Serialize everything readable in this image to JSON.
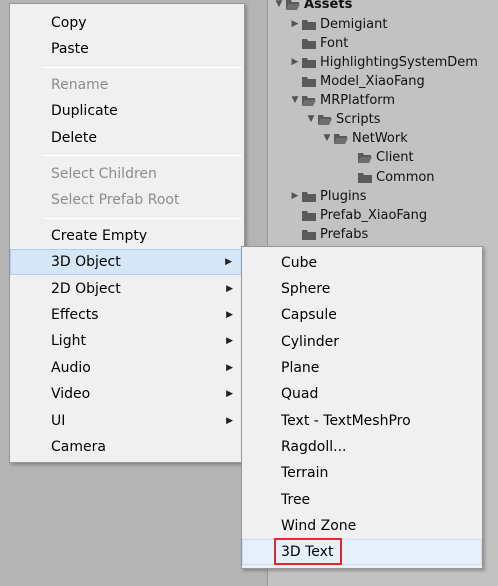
{
  "project_tree": [
    {
      "label": "Assets",
      "arrow": "▼"
    },
    {
      "label": "Demigiant",
      "arrow": "▶"
    },
    {
      "label": "Font",
      "arrow": ""
    },
    {
      "label": "HighlightingSystemDem",
      "arrow": "▶"
    },
    {
      "label": "Model_XiaoFang",
      "arrow": ""
    },
    {
      "label": "MRPlatform",
      "arrow": "▼"
    },
    {
      "label": "Scripts",
      "arrow": "▼"
    },
    {
      "label": "NetWork",
      "arrow": "▼"
    },
    {
      "label": "Client",
      "arrow": ""
    },
    {
      "label": "Common",
      "arrow": ""
    },
    {
      "label": "Plugins",
      "arrow": "▶"
    },
    {
      "label": "Prefab_XiaoFang",
      "arrow": ""
    },
    {
      "label": "Prefabs",
      "arrow": ""
    }
  ],
  "context_menu": {
    "copy": "Copy",
    "paste": "Paste",
    "rename": "Rename",
    "duplicate": "Duplicate",
    "delete": "Delete",
    "select_children": "Select Children",
    "select_prefab_root": "Select Prefab Root",
    "create_empty": "Create Empty",
    "object_3d": "3D Object",
    "object_2d": "2D Object",
    "effects": "Effects",
    "light": "Light",
    "audio": "Audio",
    "video": "Video",
    "ui": "UI",
    "camera": "Camera",
    "submenu_arrow": "▶"
  },
  "submenu": {
    "cube": "Cube",
    "sphere": "Sphere",
    "capsule": "Capsule",
    "cylinder": "Cylinder",
    "plane": "Plane",
    "quad": "Quad",
    "text_meshpro": "Text - TextMeshPro",
    "ragdoll": "Ragdoll...",
    "terrain": "Terrain",
    "tree": "Tree",
    "wind_zone": "Wind Zone",
    "text_3d": "3D Text"
  },
  "colors": {
    "menu_bg": "#f0f0f0",
    "highlight": "#d5e6f7",
    "annotation": "#e0282e",
    "folder": "#5a5a5a"
  }
}
